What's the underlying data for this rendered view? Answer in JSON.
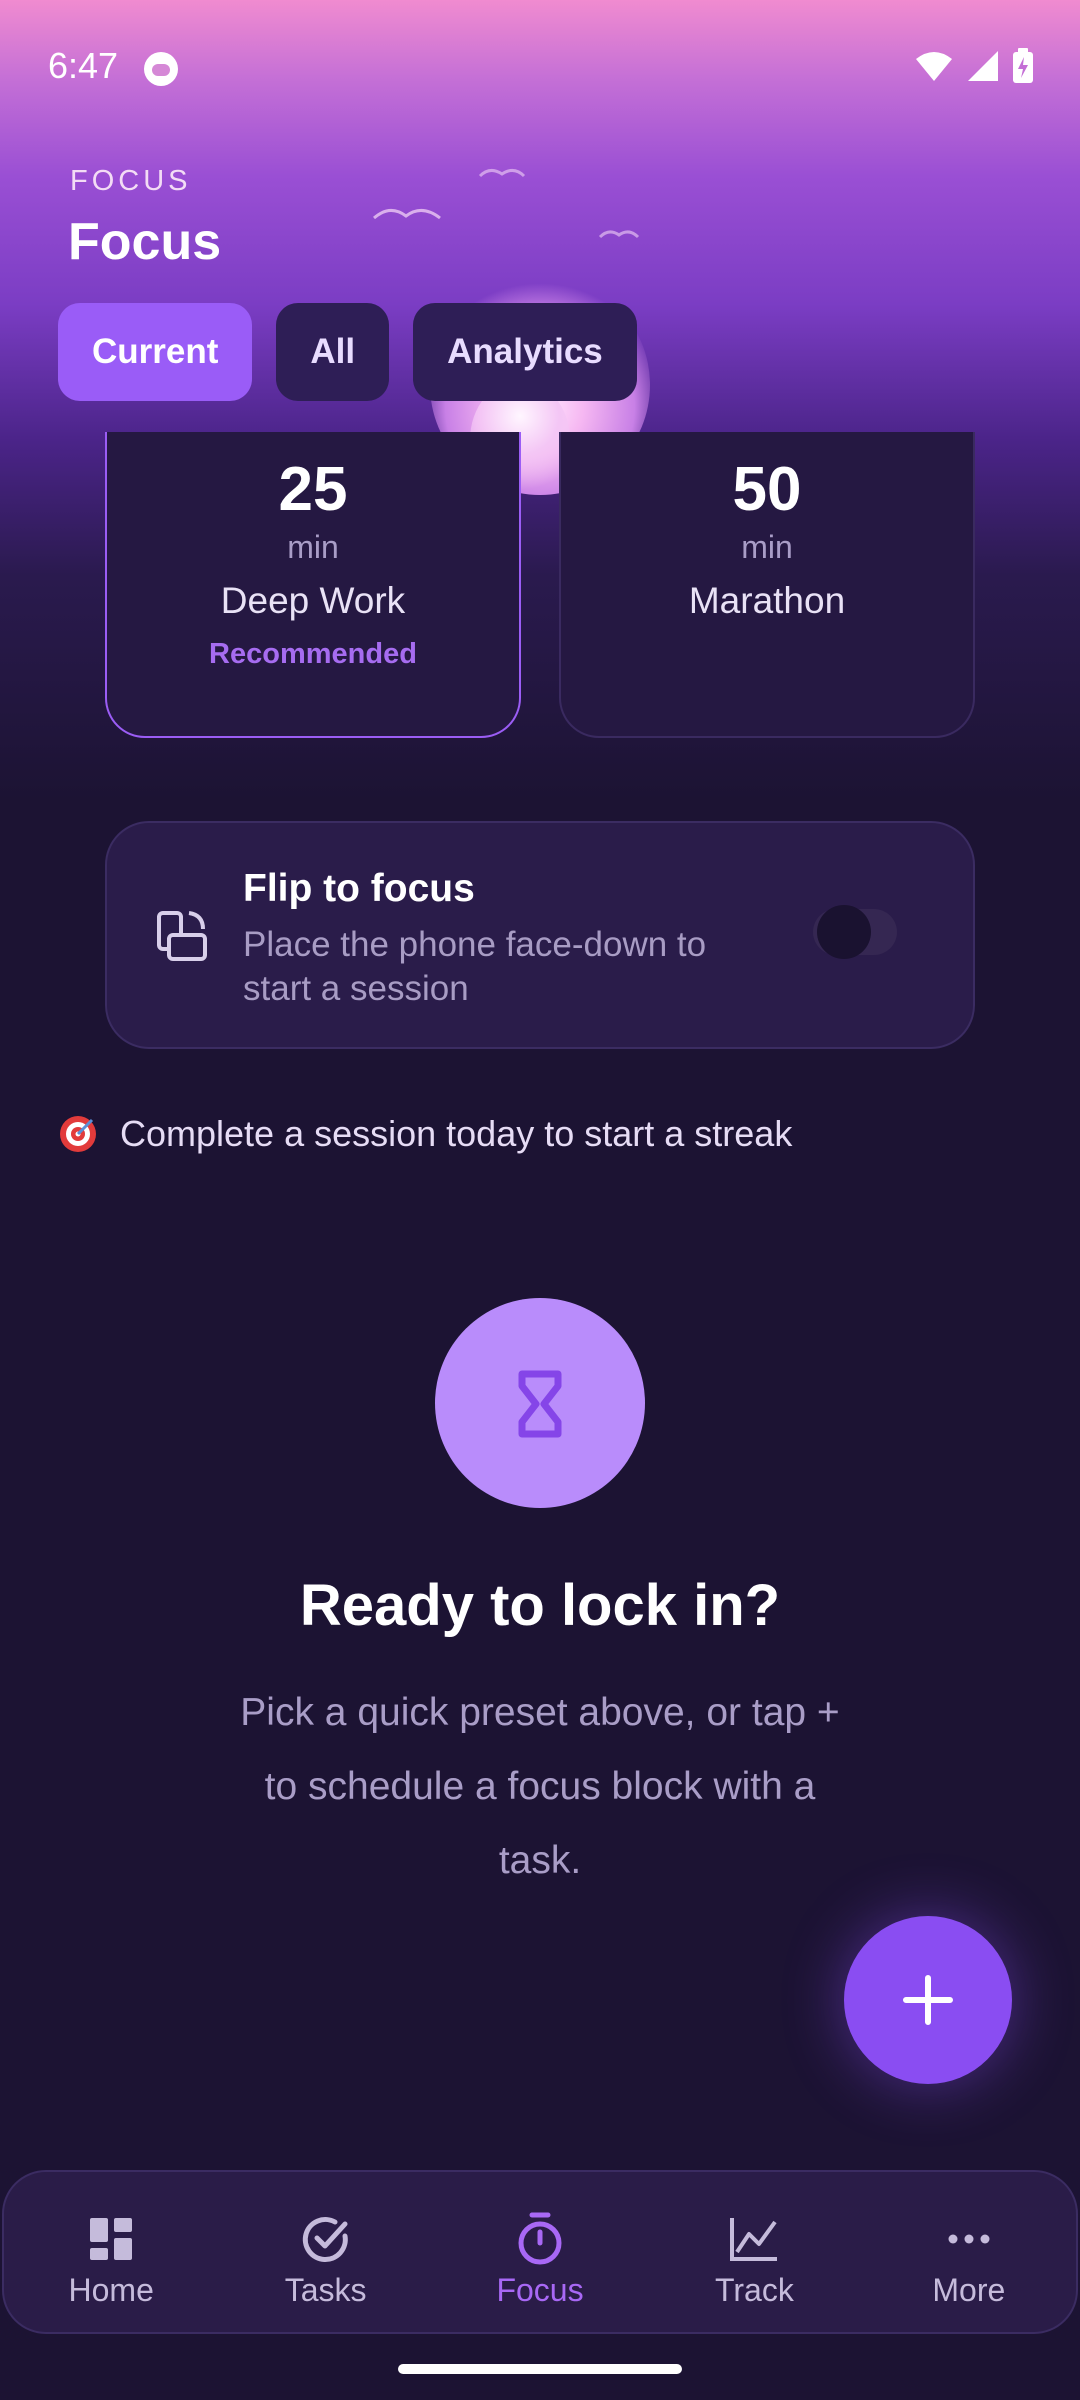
{
  "status_bar": {
    "time": "6:47"
  },
  "header": {
    "eyebrow": "FOCUS",
    "title": "Focus"
  },
  "tabs": [
    {
      "label": "Current",
      "active": true
    },
    {
      "label": "All",
      "active": false
    },
    {
      "label": "Analytics",
      "active": false
    }
  ],
  "presets": [
    {
      "minutes": "25",
      "unit": "min",
      "name": "Deep Work",
      "badge": "Recommended"
    },
    {
      "minutes": "50",
      "unit": "min",
      "name": "Marathon",
      "badge": ""
    }
  ],
  "flip": {
    "title": "Flip to focus",
    "description": "Place the phone face-down to start a session",
    "enabled": false
  },
  "streak": {
    "icon": "target-icon",
    "text": "Complete a session today to start a streak"
  },
  "empty_state": {
    "icon": "hourglass-icon",
    "title": "Ready to lock in?",
    "hint": "Pick a quick preset above, or tap + to schedule a focus block with a task."
  },
  "nav": [
    {
      "label": "Home",
      "icon": "dashboard-icon",
      "active": false
    },
    {
      "label": "Tasks",
      "icon": "check-circle-icon",
      "active": false
    },
    {
      "label": "Focus",
      "icon": "timer-icon",
      "active": true
    },
    {
      "label": "Track",
      "icon": "chart-line-icon",
      "active": false
    },
    {
      "label": "More",
      "icon": "more-horizontal-icon",
      "active": false
    }
  ],
  "colors": {
    "accent": "#9a5cf7",
    "background": "#1c1333",
    "card": "#251842"
  }
}
